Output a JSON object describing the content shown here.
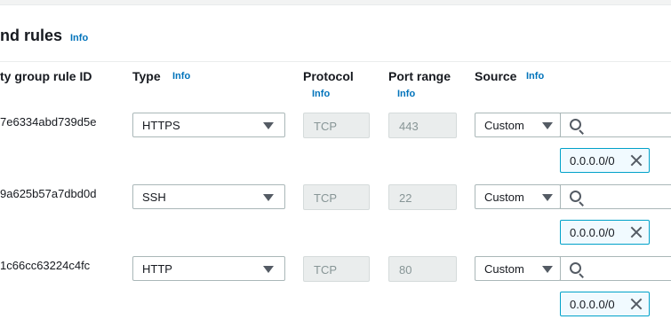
{
  "section": {
    "title": "nd rules",
    "info": "Info"
  },
  "columns": {
    "rule_id": "ty group rule ID",
    "type": "Type",
    "type_info": "Info",
    "protocol": "Protocol",
    "protocol_info": "Info",
    "port_range": "Port range",
    "port_range_info": "Info",
    "source": "Source",
    "source_info": "Info"
  },
  "rules": [
    {
      "rule_id": "7e6334abd739d5e",
      "type": "HTTPS",
      "protocol": "TCP",
      "port": "443",
      "source": "Custom",
      "cidr": "0.0.0.0/0"
    },
    {
      "rule_id": "9a625b57a7dbd0d",
      "type": "SSH",
      "protocol": "TCP",
      "port": "22",
      "source": "Custom",
      "cidr": "0.0.0.0/0"
    },
    {
      "rule_id": "1c66cc63224c4fc",
      "type": "HTTP",
      "protocol": "TCP",
      "port": "80",
      "source": "Custom",
      "cidr": "0.0.0.0/0"
    }
  ],
  "colors": {
    "info_link": "#0073bb",
    "token_border": "#00a1c9",
    "token_bg": "#f1faff",
    "disabled_bg": "#eaeded"
  },
  "icons": {
    "select_caret": "caret-down-icon",
    "search": "search-icon",
    "dismiss": "close-icon"
  }
}
